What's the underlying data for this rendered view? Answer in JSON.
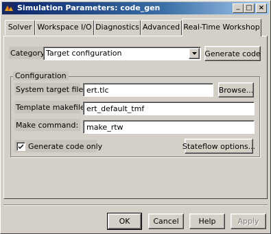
{
  "window": {
    "title": "Simulation Parameters: code_gen",
    "controls": {
      "minimize": "_",
      "maximize": "□",
      "close": "×"
    }
  },
  "tabs": [
    {
      "label": "Solver"
    },
    {
      "label": "Workspace I/O"
    },
    {
      "label": "Diagnostics"
    },
    {
      "label": "Advanced"
    },
    {
      "label": "Real-Time Workshop",
      "active": true
    }
  ],
  "category": {
    "label": "Category:",
    "value": "Target configuration",
    "generate_button": "Generate code"
  },
  "configuration": {
    "group_title": "Configuration",
    "system_target_label": "System target file:",
    "system_target_value": "ert.tlc",
    "browse_button": "Browse...",
    "template_makefile_label": "Template makefile:",
    "template_makefile_value": "ert_default_tmf",
    "make_command_label": "Make command:",
    "make_command_value": "make_rtw",
    "generate_code_only_label": "Generate code only",
    "generate_code_only_checked": true,
    "stateflow_button": "Stateflow options..."
  },
  "footer": {
    "ok": "OK",
    "cancel": "Cancel",
    "help": "Help",
    "apply": "Apply"
  }
}
